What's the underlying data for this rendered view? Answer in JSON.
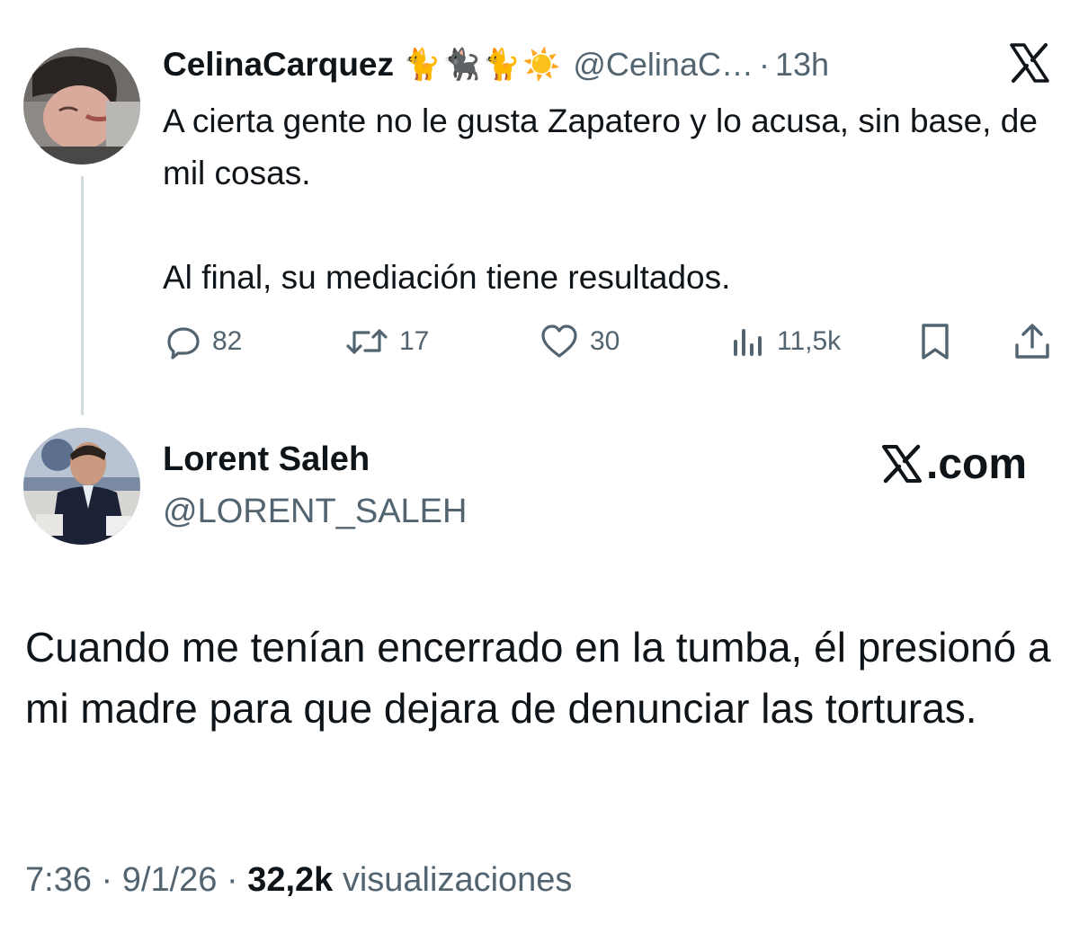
{
  "reply_tweet": {
    "author_name": "CelinaCarquez",
    "name_emoji": "🐈🐈‍⬛🐈☀️",
    "handle": "@CelinaC…",
    "separator": "·",
    "time": "13h",
    "text_lines": [
      "A cierta gente no le gusta Zapatero y lo acusa, sin base, de mil cosas.",
      "Al final, su mediación tiene resultados."
    ],
    "actions": {
      "replies": "82",
      "reposts": "17",
      "likes": "30",
      "views": "11,5k"
    }
  },
  "quoted_tweet": {
    "author_name": "Lorent Saleh",
    "handle": "@LORENT_SALEH",
    "brand_text": ".com",
    "text": "Cuando me tenían encerrado en la tumba, él presionó a mi madre para que dejara de denunciar las torturas.",
    "time": "7:36",
    "date": "9/1/26",
    "separator": "·",
    "views_count": "32,2k",
    "views_label": "visualizaciones"
  },
  "colors": {
    "text_primary": "#0f1419",
    "text_secondary": "#536471",
    "thread_line": "#cfd9de",
    "background": "#ffffff"
  },
  "icons": [
    "reply-icon",
    "repost-icon",
    "like-icon",
    "views-icon",
    "bookmark-icon",
    "share-icon",
    "x-logo-icon"
  ]
}
